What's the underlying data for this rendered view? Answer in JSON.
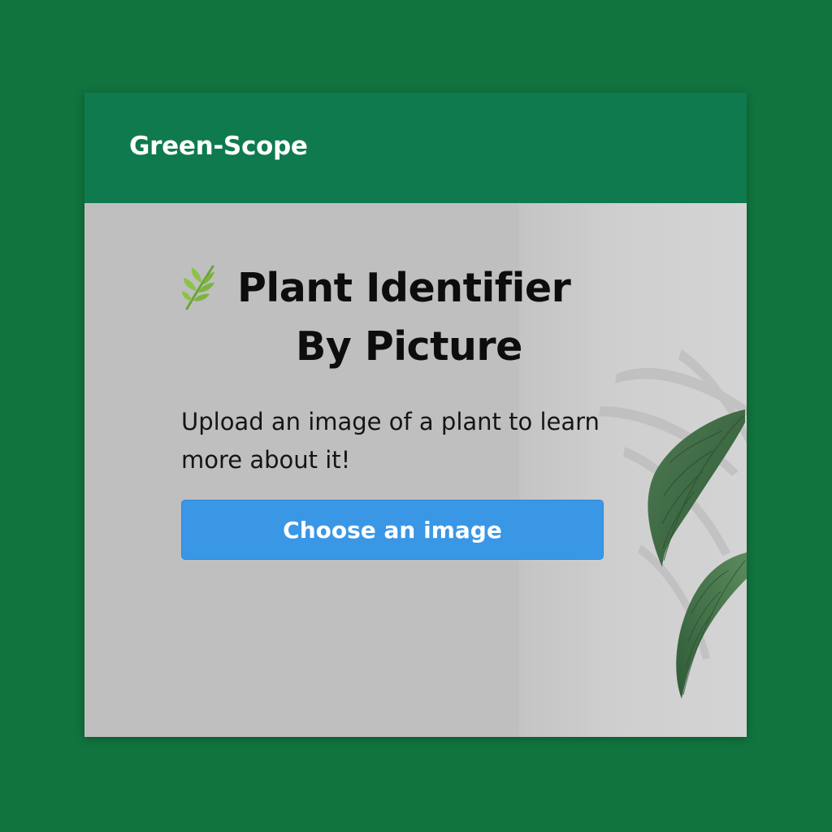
{
  "app": {
    "brand": "Green-Scope"
  },
  "hero": {
    "leaf_icon": "herb-leaf-icon",
    "title_line1": "Plant Identifier",
    "title_line2": "By Picture",
    "subtitle": "Upload an image of a plant to learn more about it!",
    "button_label": "Choose an image"
  },
  "colors": {
    "page_background": "#11733e",
    "header_background": "#0f7a4d",
    "content_background": "#bfbfbf",
    "button_background": "#3a97e6",
    "button_text": "#ffffff",
    "title_text": "#0d0d0d"
  },
  "decoration": {
    "photo": "potted-plant-leaves-photo"
  }
}
